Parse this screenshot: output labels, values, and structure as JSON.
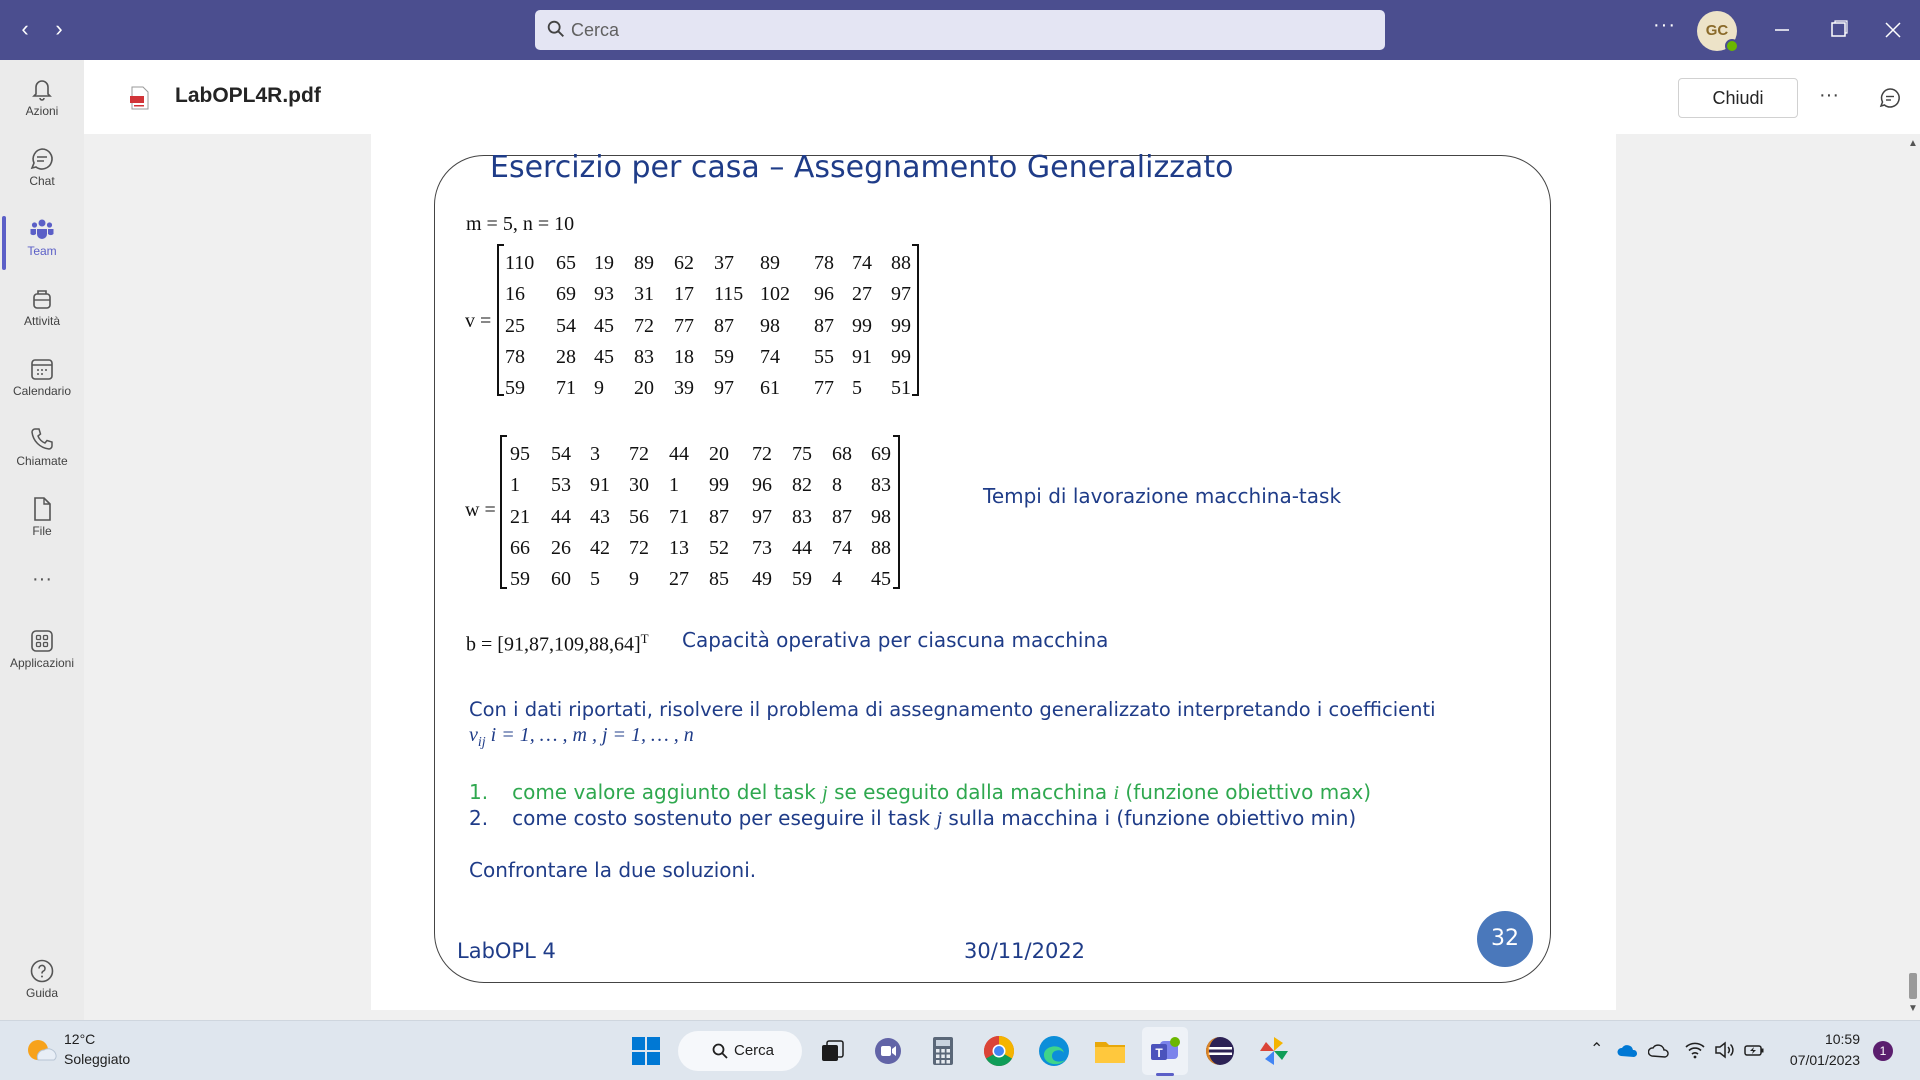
{
  "titlebar": {
    "search_placeholder": "Cerca",
    "avatar_initials": "GC"
  },
  "rail": [
    {
      "label": "Azioni",
      "icon": "bell-icon"
    },
    {
      "label": "Chat",
      "icon": "chat-icon"
    },
    {
      "label": "Team",
      "icon": "teams-icon",
      "active": true
    },
    {
      "label": "Attività",
      "icon": "briefcase-icon"
    },
    {
      "label": "Calendario",
      "icon": "calendar-icon"
    },
    {
      "label": "Chiamate",
      "icon": "phone-icon"
    },
    {
      "label": "File",
      "icon": "file-icon"
    },
    {
      "label": "Applicazioni",
      "icon": "apps-icon"
    },
    {
      "label": "Guida",
      "icon": "help-icon"
    }
  ],
  "file": {
    "name": "LabOPL4R.pdf",
    "close_label": "Chiudi"
  },
  "slide": {
    "title": "Esercizio per casa  – Assegnamento Generalizzato",
    "mn_line": "m = 5, n = 10",
    "v_label": "v =",
    "v_matrix": [
      [
        "110",
        "65",
        "19",
        "89",
        "62",
        "37",
        "89",
        "78",
        "74",
        "88"
      ],
      [
        "16",
        "69",
        "93",
        "31",
        "17",
        "115",
        "102",
        "96",
        "27",
        "97"
      ],
      [
        "25",
        "54",
        "45",
        "72",
        "77",
        "87",
        "98",
        "87",
        "99",
        "99"
      ],
      [
        "78",
        "28",
        "45",
        "83",
        "18",
        "59",
        "74",
        "55",
        "91",
        "99"
      ],
      [
        "59",
        "71",
        "9",
        "20",
        "39",
        "97",
        "61",
        "77",
        "5",
        "51"
      ]
    ],
    "w_label": "w =",
    "w_matrix": [
      [
        "95",
        "54",
        "3",
        "72",
        "44",
        "20",
        "72",
        "75",
        "68",
        "69"
      ],
      [
        "1",
        "53",
        "91",
        "30",
        "1",
        "99",
        "96",
        "82",
        "8",
        "83"
      ],
      [
        "21",
        "44",
        "43",
        "56",
        "71",
        "87",
        "97",
        "83",
        "87",
        "98"
      ],
      [
        "66",
        "26",
        "42",
        "72",
        "13",
        "52",
        "73",
        "44",
        "74",
        "88"
      ],
      [
        "59",
        "60",
        "5",
        "9",
        "27",
        "85",
        "49",
        "59",
        "4",
        "45"
      ]
    ],
    "w_caption": "Tempi di lavorazione macchina-task",
    "b_line": "b = [91,87,109,88,64]",
    "b_sup": "T",
    "b_caption": "Capacità operativa per ciascuna macchina",
    "paragraph_line1": "Con i dati riportati, risolvere il problema di assegnamento generalizzato interpretando i coefficienti",
    "paragraph_line2": "v",
    "paragraph_line2_sub": "ij",
    "paragraph_line2_rest": "  i = 1, … , m , j = 1, … , n",
    "item1_num": "1.",
    "item1_a": "come valore aggiunto del task ",
    "item1_j": "j",
    "item1_b": " se eseguito dalla macchina ",
    "item1_i": "i",
    "item1_c": " (funzione obiettivo max)",
    "item2_num": "2.",
    "item2_a": "come costo sostenuto per eseguire il task ",
    "item2_j": "j",
    "item2_b": " sulla macchina i (funzione obiettivo min)",
    "conclusion": "Confrontare la due soluzioni.",
    "footer_left": "LabOPL 4",
    "footer_center": "30/11/2022",
    "page_number": "32"
  },
  "taskbar": {
    "weather_temp": "12°C",
    "weather_desc": "Soleggiato",
    "search_label": "Cerca",
    "time": "10:59",
    "date": "07/01/2023",
    "notifications": "1"
  },
  "colors": {
    "titlebar": "#4b4e8f",
    "accent": "#5b5fc7",
    "slide_blue": "#1f3c88",
    "slide_green": "#2fa84f"
  }
}
